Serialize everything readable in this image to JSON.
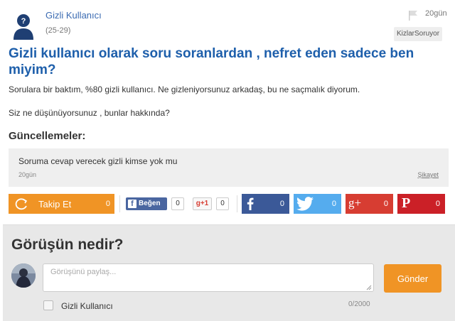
{
  "question": {
    "author_name": "Gizli Kullanıcı",
    "author_age": "(25-29)",
    "time": "20gün",
    "source_tag": "KizlarSoruyor",
    "title": "Gizli kullanıcı olarak soru soranlardan , nefret eden sadece ben miyim?",
    "body_paragraphs": [
      "Sorulara bir baktım, %80 gizli kullanıcı. Ne gizleniyorsunuz arkadaş, bu ne saçmalık diyorum.",
      "Siz ne düşünüyorsunuz , bunlar hakkında?"
    ]
  },
  "updates": {
    "heading": "Güncellemeler:",
    "items": [
      {
        "text": "Soruma cevap verecek gizli kimse yok mu",
        "time": "20gün",
        "report_label": "Şikayet"
      }
    ]
  },
  "actions": {
    "follow": {
      "label": "Takip Et",
      "count": "0"
    },
    "fb_like": {
      "label": "Beğen",
      "count": "0"
    },
    "gplus_one": {
      "label": "g+1",
      "count": "0"
    },
    "shares": [
      {
        "network": "facebook",
        "glyph": "f",
        "count": "0",
        "color": "#3b5998"
      },
      {
        "network": "twitter",
        "glyph": "",
        "count": "0",
        "color": "#55acee"
      },
      {
        "network": "google-plus",
        "glyph": "g+",
        "count": "0",
        "color": "#d73d32"
      },
      {
        "network": "pinterest",
        "glyph": "P",
        "count": "0",
        "color": "#cb2027"
      }
    ]
  },
  "comment_form": {
    "heading": "Görüşün nedir?",
    "placeholder": "Görüşünü paylaş...",
    "value": "",
    "submit_label": "Gönder",
    "anonymous_label": "Gizli Kullanıcı",
    "anonymous_checked": false,
    "char_counter": "0/2000"
  },
  "colors": {
    "link_blue": "#3b6bb2",
    "title_blue": "#1e5fab",
    "accent_orange": "#f09425"
  }
}
